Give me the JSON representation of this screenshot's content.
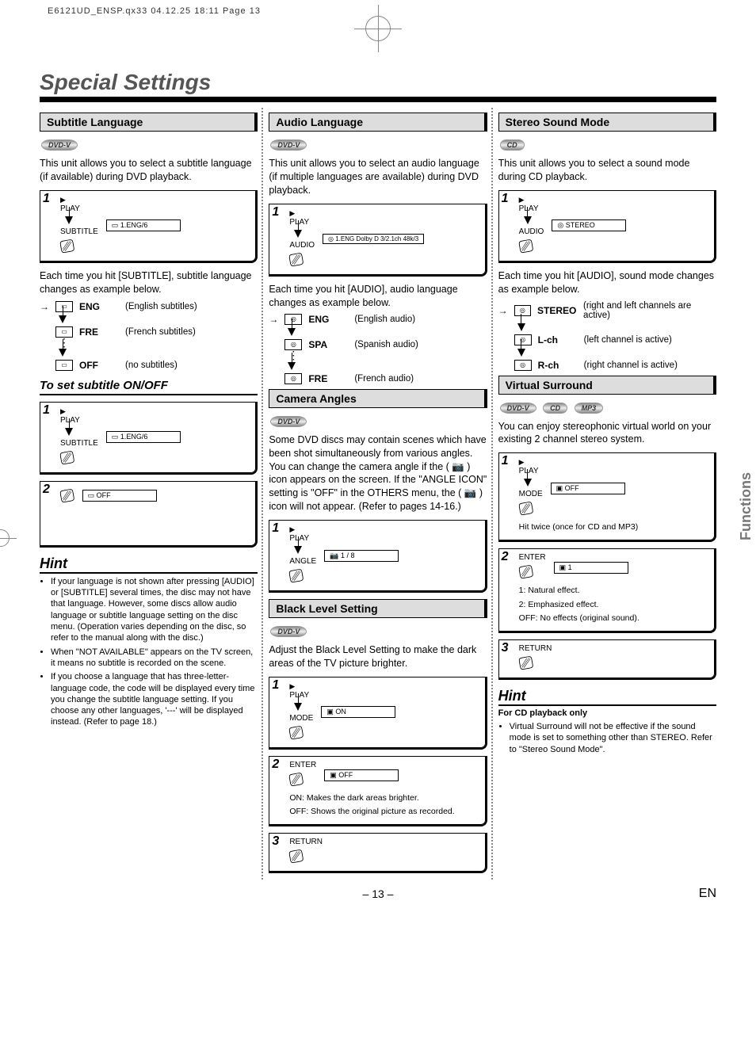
{
  "header_line": "E6121UD_ENSP.qx33  04.12.25 18:11  Page 13",
  "page_title": "Special Settings",
  "side_tab": "Functions",
  "page_number": "– 13 –",
  "lang_code": "EN",
  "media": {
    "dvdv": "DVD-V",
    "cd": "CD",
    "mp3": "MP3"
  },
  "common": {
    "play_label": "PLAY",
    "subtitle_btn": "SUBTITLE",
    "audio_btn": "AUDIO",
    "mode_btn": "MODE",
    "enter_btn": "ENTER",
    "return_btn": "RETURN",
    "angle_btn": "ANGLE"
  },
  "subtitle": {
    "head": "Subtitle Language",
    "intro": "This unit allows you to select a subtitle language (if available) during DVD playback.",
    "osd1": "1.ENG/6",
    "cycle_intro": "Each time you hit [SUBTITLE], subtitle language changes as example below.",
    "rows": [
      {
        "label": "ENG",
        "desc": "(English subtitles)"
      },
      {
        "label": "FRE",
        "desc": "(French subtitles)"
      },
      {
        "label": "OFF",
        "desc": "(no subtitles)"
      }
    ],
    "onoff_head": "To set subtitle ON/OFF",
    "osd2": "1.ENG/6",
    "osd3": "OFF"
  },
  "hint1": {
    "head": "Hint",
    "items": [
      "If your language is not shown after pressing [AUDIO] or [SUBTITLE] several times, the disc may not have that language. However, some discs allow audio language or subtitle language setting on the disc menu. (Operation varies depending on the disc, so refer to the manual along with the disc.)",
      "When \"NOT AVAILABLE\" appears on the TV screen, it means no subtitle is recorded on the scene.",
      "If you choose a language that has three-letter-language code, the code will be displayed every time you change the subtitle language setting. If you choose any other languages, '---' will be displayed instead. (Refer to page 18.)"
    ]
  },
  "audio": {
    "head": "Audio Language",
    "intro": "This unit allows you to select an audio language (if multiple languages are available) during DVD playback.",
    "osd1": "1.ENG Dolby D 3/2.1ch 48k/3",
    "cycle_intro": "Each time you hit [AUDIO], audio language changes as example below.",
    "rows": [
      {
        "label": "ENG",
        "desc": "(English audio)"
      },
      {
        "label": "SPA",
        "desc": "(Spanish audio)"
      },
      {
        "label": "FRE",
        "desc": "(French audio)"
      }
    ]
  },
  "camera": {
    "head": "Camera Angles",
    "intro": "Some DVD discs may contain scenes which have been shot simultaneously from various angles. You can change the camera angle if the ( 📷 ) icon appears on the screen. If the \"ANGLE ICON\" setting is \"OFF\" in the OTHERS menu, the ( 📷 ) icon will not appear. (Refer to pages 14-16.)",
    "osd1": "1 / 8"
  },
  "black": {
    "head": "Black Level Setting",
    "intro": "Adjust the Black Level Setting to make the dark areas of the TV picture brighter.",
    "osd1": "ON",
    "osd2": "OFF",
    "note1": "ON: Makes the dark areas brighter.",
    "note2": "OFF: Shows the original picture as recorded."
  },
  "stereo": {
    "head": "Stereo Sound Mode",
    "intro": "This unit allows you to select a sound mode during CD playback.",
    "osd1": "STEREO",
    "cycle_intro": "Each time you hit [AUDIO], sound mode changes as example below.",
    "rows": [
      {
        "label": "STEREO",
        "desc": "(right and left channels are active)"
      },
      {
        "label": "L-ch",
        "desc": "(left channel is active)"
      },
      {
        "label": "R-ch",
        "desc": "(right channel is active)"
      }
    ]
  },
  "virtual": {
    "head": "Virtual Surround",
    "intro": "You can enjoy stereophonic virtual world on your existing 2 channel stereo system.",
    "osd1": "OFF",
    "twice": "Hit twice (once for CD and MP3)",
    "osd2": "1",
    "notes": [
      "1: Natural effect.",
      "2: Emphasized effect.",
      "OFF: No effects (original sound)."
    ]
  },
  "hint2": {
    "head": "Hint",
    "sub": "For CD playback only",
    "item": "Virtual Surround will not be effective if the sound mode is set to something other than STEREO. Refer to \"Stereo Sound Mode\"."
  }
}
